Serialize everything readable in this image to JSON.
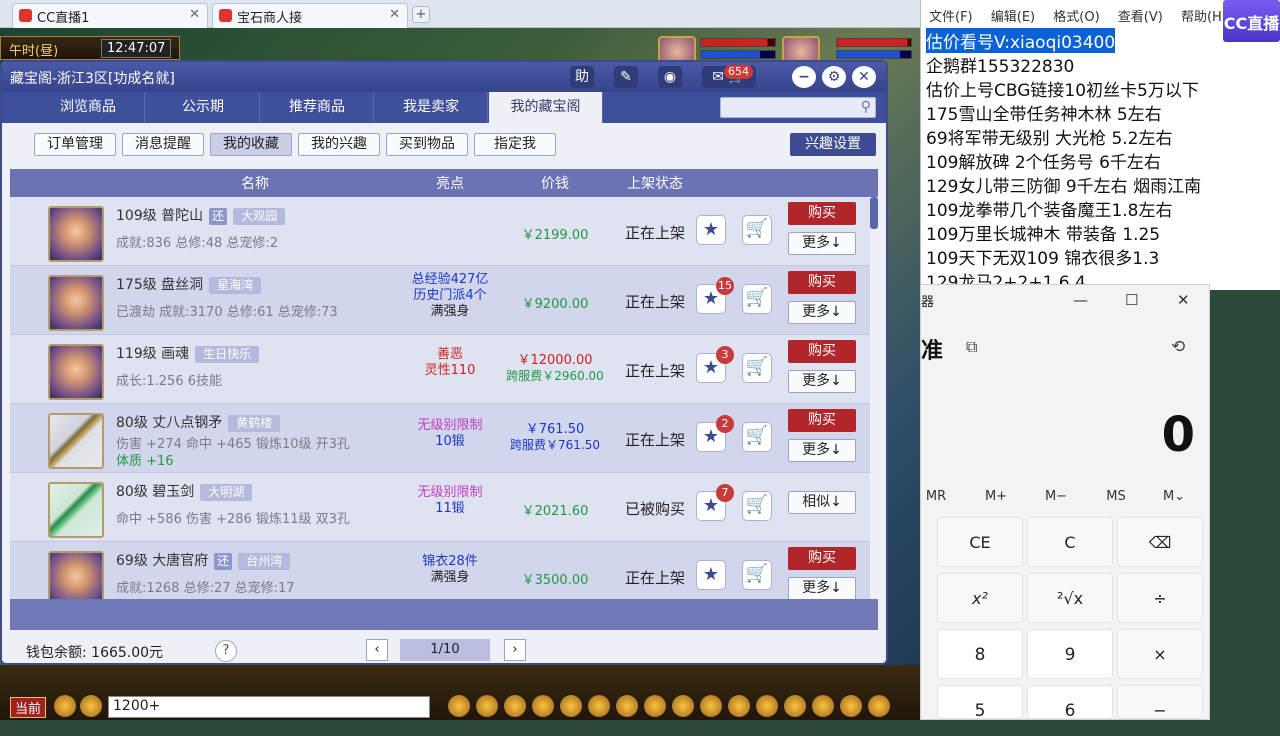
{
  "browser": {
    "tabs": [
      {
        "label": "CC直播1"
      },
      {
        "label": "宝石商人接"
      }
    ],
    "close_glyph": "✕",
    "add_glyph": "+"
  },
  "game": {
    "time_label": "午时(昼)",
    "clock": "12:47:07",
    "chat_channel": "当前",
    "chat_input_value": "1200+"
  },
  "panel": {
    "title": "藏宝阁-浙江3区[功成名就]",
    "help_label": "助",
    "message_count": "654",
    "main_tabs": [
      {
        "label": "浏览商品"
      },
      {
        "label": "公示期"
      },
      {
        "label": "推荐商品"
      },
      {
        "label": "我是卖家"
      },
      {
        "label": "我的藏宝阁"
      }
    ],
    "sub_tabs": [
      {
        "label": "订单管理"
      },
      {
        "label": "消息提醒"
      },
      {
        "label": "我的收藏"
      },
      {
        "label": "我的兴趣"
      },
      {
        "label": "买到物品"
      },
      {
        "label": "指定我"
      }
    ],
    "interest_settings_label": "兴趣设置",
    "columns": {
      "name": "名称",
      "highlights": "亮点",
      "price": "价钱",
      "status": "上架状态"
    },
    "rows": [
      {
        "line1": "109级  普陀山",
        "tag_sq": "还",
        "tag": "大观园",
        "line2": "成就:836 总修:48 总宠修:2",
        "hl1": "",
        "hl2": "",
        "price": "￥2199.00",
        "price2": "",
        "status": "正在上架",
        "badge": "",
        "buy": "购买",
        "more": "更多↓"
      },
      {
        "line1": "175级  盘丝洞",
        "tag_sq": "",
        "tag": "星海湾",
        "line2": "已渡劫 成就:3170 总修:61 总宠修:73",
        "hl1": "总经验427亿",
        "hl2": "历史门派4个",
        "hl3": "满强身",
        "price": "￥9200.00",
        "price2": "",
        "status": "正在上架",
        "badge": "15",
        "buy": "购买",
        "more": "更多↓"
      },
      {
        "line1": "119级  画魂",
        "tag_sq": "",
        "tag": "生日快乐",
        "line2": "成长:1.256 6技能",
        "hl1": "善恶",
        "hl2": "灵性110",
        "price": "￥12000.00",
        "price2": "跨服费￥2960.00",
        "status": "正在上架",
        "badge": "3",
        "buy": "购买",
        "more": "更多↓"
      },
      {
        "line1": "80级  丈八点钢矛",
        "tag_sq": "",
        "tag": "黄鹤楼",
        "line2": "伤害 +274 命中 +465 锻炼10级 开3孔",
        "line3": "体质 +16",
        "hl1": "无级别限制",
        "hl2": "10锻",
        "price": "￥761.50",
        "price2": "跨服费￥761.50",
        "status": "正在上架",
        "badge": "2",
        "buy": "购买",
        "more": "更多↓"
      },
      {
        "line1": "80级  碧玉剑",
        "tag_sq": "",
        "tag": "大明湖",
        "line2": "命中 +586 伤害 +286 锻炼11级 双3孔",
        "hl1": "无级别限制",
        "hl2": "11锻",
        "price": "￥2021.60",
        "price2": "",
        "status": "已被购买",
        "badge": "7",
        "buy": "",
        "more": "相似↓"
      },
      {
        "line1": "69级  大唐官府",
        "tag_sq": "还",
        "tag": "台州湾",
        "line2": "成就:1268 总修:27 总宠修:17",
        "hl1": "锦衣28件",
        "hl2": "满强身",
        "price": "￥3500.00",
        "price2": "",
        "status": "正在上架",
        "badge": "",
        "buy": "购买",
        "more": "更多↓"
      }
    ],
    "wallet": "钱包余额: 1665.00元",
    "help_q": "?",
    "page_info": "1/10",
    "prev": "‹",
    "next": "›"
  },
  "notepad": {
    "menu": [
      "文件(F)",
      "编辑(E)",
      "格式(O)",
      "查看(V)",
      "帮助(H)"
    ],
    "lines": [
      "估价看号V:xiaoqi03400",
      "企鹅群155322830",
      "估价上号CBG链接10初丝卡5万以下",
      "175雪山全带任务神木林 5左右",
      "69将军带无级别 大光枪 5.2左右",
      "109解放碑 2个任务号 6千左右",
      "129女儿带三防御 9千左右 烟雨江南",
      "109龙拳带几个装备魔王1.8左右",
      "109万里长城神木 带装备  1.25",
      "109天下无双109  锦衣很多1.3",
      "129龙马2+2+1  6.4"
    ]
  },
  "cc_logo": "CC直播",
  "calculator": {
    "title": "器",
    "mode": "准",
    "display": "0",
    "memory": [
      "MR",
      "M+",
      "M−",
      "MS",
      "M⌄"
    ],
    "keys": [
      "CE",
      "C",
      "⌫",
      "x²",
      "²√x",
      "÷",
      "8",
      "9",
      "×",
      "5",
      "6",
      "−"
    ]
  }
}
